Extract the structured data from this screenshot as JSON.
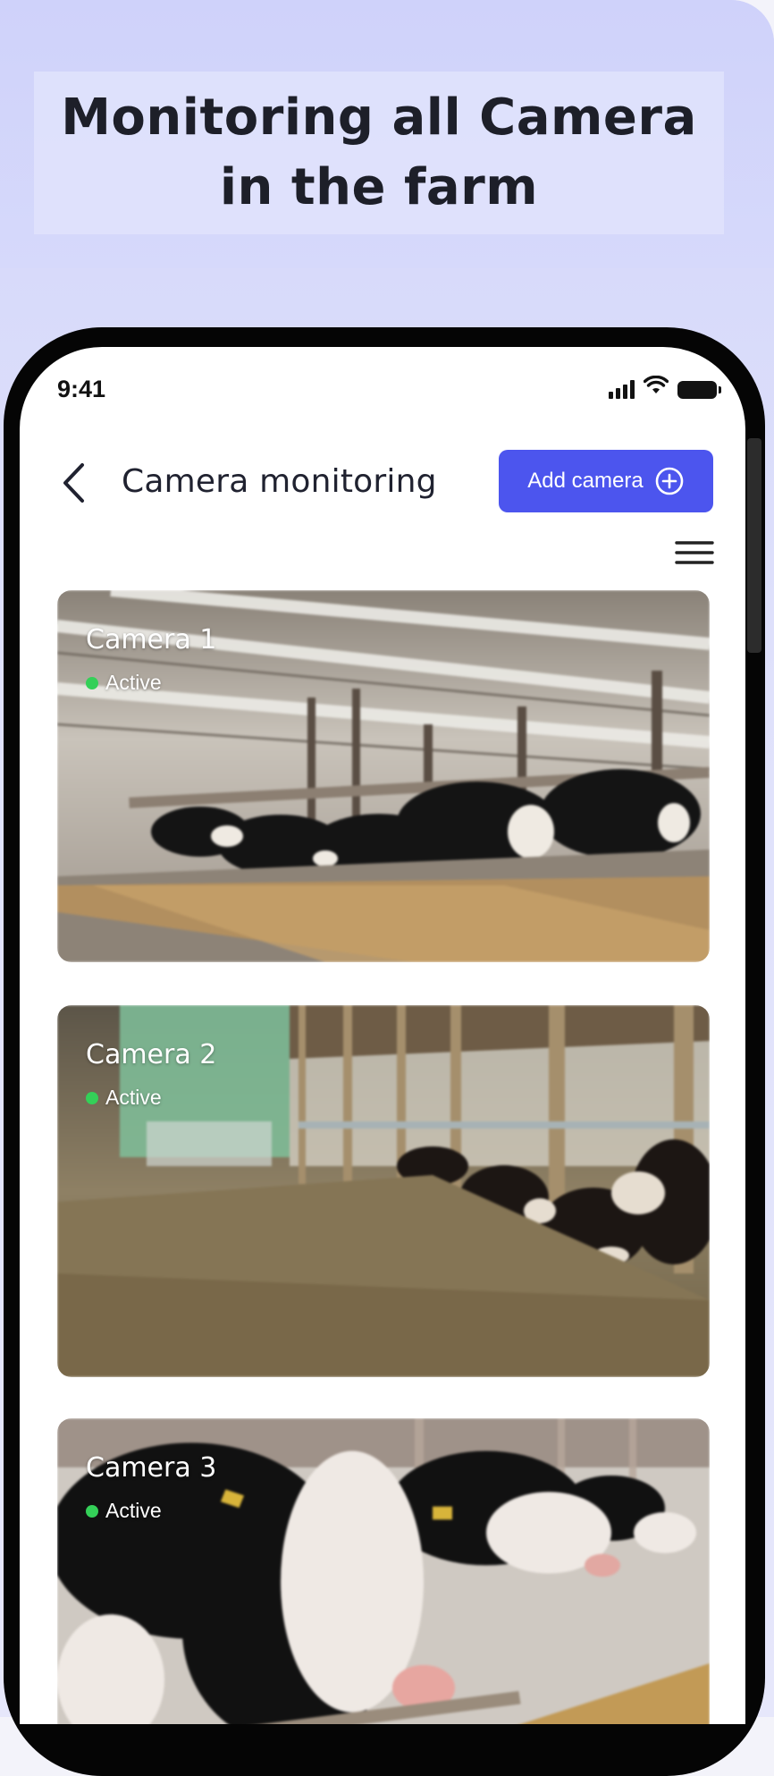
{
  "hero": {
    "headline_line1": "Monitoring all Camera",
    "headline_line2": "in the farm"
  },
  "status_bar": {
    "time": "9:41",
    "icons": [
      "signal-icon",
      "wifi-icon",
      "battery-icon"
    ]
  },
  "header": {
    "title": "Camera monitoring",
    "back_icon": "chevron-left-icon",
    "add_button_label": "Add camera",
    "add_button_icon": "plus-circle-icon",
    "menu_icon": "hamburger-menu-icon"
  },
  "cameras": [
    {
      "name": "Camera 1",
      "status": "Active"
    },
    {
      "name": "Camera 2",
      "status": "Active"
    },
    {
      "name": "Camera 3",
      "status": "Active"
    }
  ],
  "colors": {
    "accent": "#4c55ee",
    "active_dot": "#34d058",
    "hero_bg": "#d3d6fa"
  }
}
